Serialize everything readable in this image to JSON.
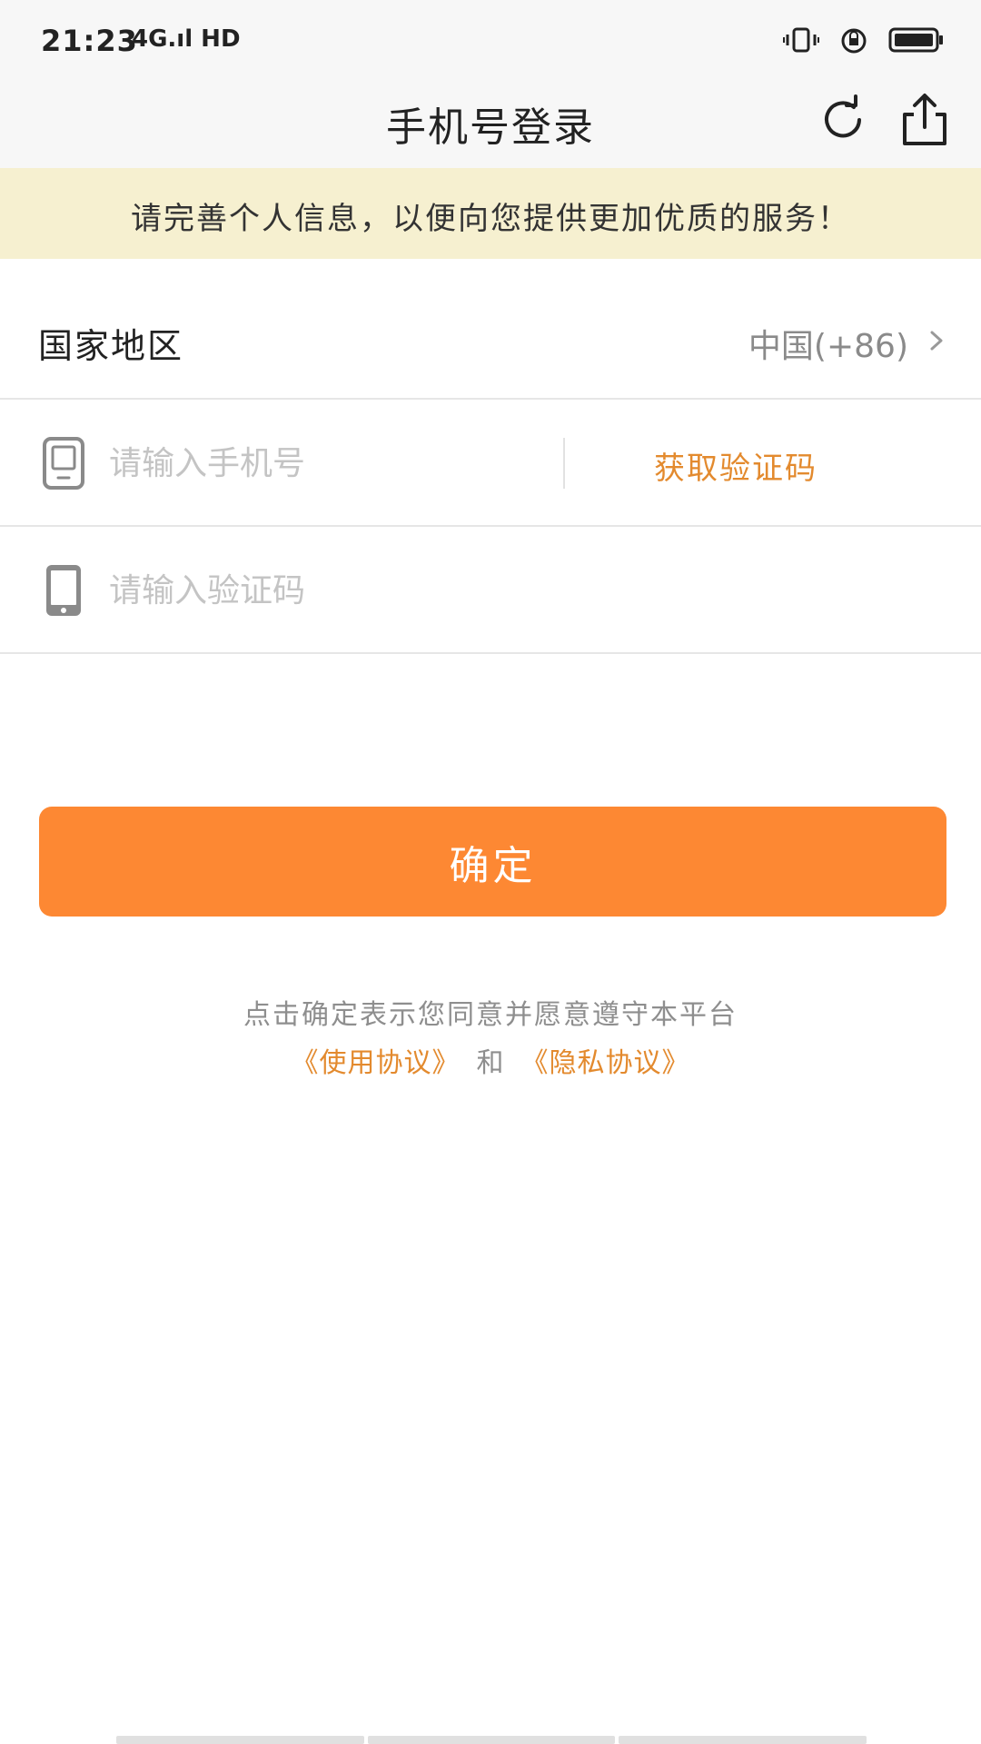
{
  "status_bar": {
    "time": "21:23",
    "signal_text": "4G.ıl HD",
    "icons": [
      "vibrate-icon",
      "alarm-icon",
      "battery-icon"
    ]
  },
  "header": {
    "title": "手机号登录",
    "icons": [
      "refresh-icon",
      "share-icon"
    ]
  },
  "notice": {
    "text": "请完善个人信息，以便向您提供更加优质的服务！"
  },
  "form": {
    "country": {
      "label": "国家地区",
      "value": "中国(+86)"
    },
    "phone": {
      "placeholder": "请输入手机号",
      "value": "",
      "get_code_label": "获取验证码"
    },
    "code": {
      "placeholder": "请输入验证码",
      "value": ""
    }
  },
  "confirm_button": {
    "label": "确定"
  },
  "agreement": {
    "line1": "点击确定表示您同意并愿意遵守本平台",
    "terms_link": "《使用协议》",
    "and_text": "和",
    "privacy_link": "《隐私协议》"
  },
  "colors": {
    "accent": "#fd8833",
    "link": "#e38a2e",
    "notice_bg": "#f6f0d0",
    "header_bg": "#f7f7f7"
  }
}
